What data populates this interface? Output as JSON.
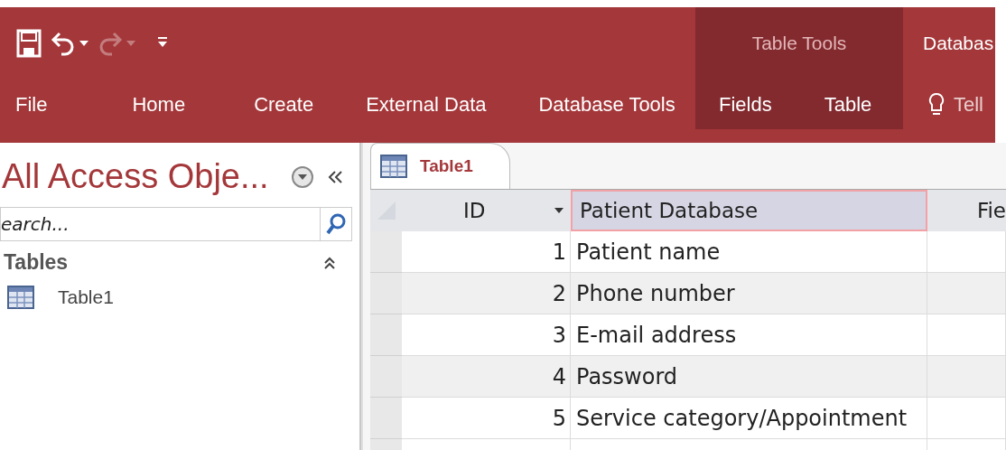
{
  "quick_access": {
    "items": [
      {
        "kind": "save",
        "disabled": false
      },
      {
        "kind": "undo",
        "disabled": false
      },
      {
        "kind": "redo",
        "disabled": true
      },
      {
        "kind": "customize",
        "disabled": false
      }
    ]
  },
  "ribbon": {
    "context_group": "Table Tools",
    "title": "Databas",
    "tabs": [
      {
        "label": "File",
        "contextual": false
      },
      {
        "label": "Home",
        "contextual": false
      },
      {
        "label": "Create",
        "contextual": false
      },
      {
        "label": "External Data",
        "contextual": false
      },
      {
        "label": "Database Tools",
        "contextual": false
      },
      {
        "label": "Fields",
        "contextual": true
      },
      {
        "label": "Table",
        "contextual": true
      }
    ],
    "tell_me": "Tell"
  },
  "nav_pane": {
    "title": "All Access Obje...",
    "search": {
      "placeholder": "earch..."
    },
    "groups": [
      {
        "label": "Tables",
        "expanded": true,
        "items": [
          {
            "label": "Table1"
          }
        ]
      }
    ]
  },
  "document_tab": {
    "label": "Table1",
    "selected": true
  },
  "table": {
    "columns": [
      {
        "label": "ID",
        "selected": false
      },
      {
        "label": "Patient Database",
        "selected": true
      },
      {
        "label": "Fie",
        "selected": false
      }
    ],
    "rows": [
      {
        "id": "1",
        "value": "Patient name"
      },
      {
        "id": "2",
        "value": "Phone number"
      },
      {
        "id": "3",
        "value": "E-mail address"
      },
      {
        "id": "4",
        "value": "Password"
      },
      {
        "id": "5",
        "value": "Service category/Appointment"
      }
    ]
  }
}
